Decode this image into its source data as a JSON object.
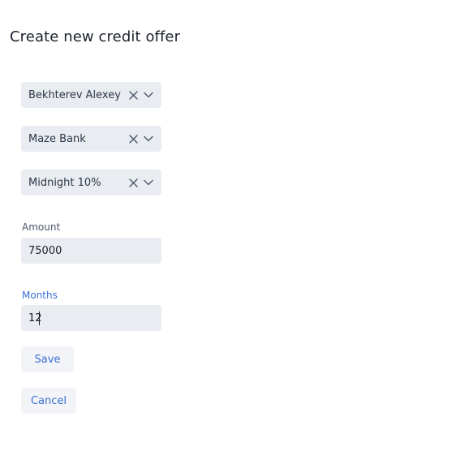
{
  "page": {
    "title": "Create new credit offer"
  },
  "client_select": {
    "value": "Bekhterev Alexey"
  },
  "bank_select": {
    "value": "Maze Bank"
  },
  "plan_select": {
    "value": "Midnight 10%"
  },
  "amount": {
    "label": "Amount",
    "value": "75000"
  },
  "months": {
    "label": "Months",
    "value": "12"
  },
  "actions": {
    "save_label": "Save",
    "cancel_label": "Cancel"
  },
  "colors": {
    "accent": "#3b6fd4",
    "field_bg": "#e9ecf0",
    "button_bg": "#f2f4f7"
  },
  "icons": {
    "clear": "close-icon",
    "open": "chevron-down-icon"
  }
}
